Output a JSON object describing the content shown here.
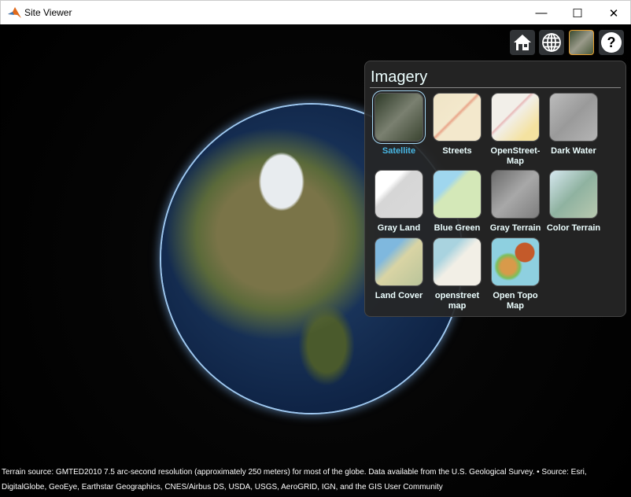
{
  "window": {
    "title": "Site Viewer",
    "minimize": "—",
    "maximize": "☐",
    "close": "✕"
  },
  "toolbar": [
    {
      "name": "home-button",
      "icon": "home-icon"
    },
    {
      "name": "globe-button",
      "icon": "globe-icon"
    },
    {
      "name": "imagery-button",
      "icon": "imagery-icon"
    },
    {
      "name": "help-button",
      "icon": "help-icon",
      "label": "?"
    }
  ],
  "imagery": {
    "title": "Imagery",
    "selected": "Satellite",
    "items": [
      {
        "label": "Satellite",
        "bg": "linear-gradient(135deg,#2e3a28,#7a8070 50%,#3a4430)"
      },
      {
        "label": "Streets",
        "bg": "linear-gradient(135deg,#efe4c6,#f3e8cc 45%,#e9a488 48%,#f3e8cc 52%)"
      },
      {
        "label": "OpenStreet-Map",
        "bg": "linear-gradient(135deg,#f2efe9 0 40%,#e8b8b8 42%,#f2efe9 46%,#f4e2a0 80%)"
      },
      {
        "label": "Dark Water",
        "bg": "linear-gradient(135deg,#bcbcbc,#9a9a9a 50%,#b5b5b5)"
      },
      {
        "label": "Gray Land",
        "bg": "linear-gradient(135deg,#fff 0 30%,#d6d6d6 40%,#d9d9d9)"
      },
      {
        "label": "Blue Green",
        "bg": "linear-gradient(135deg,#9fd6ee 0 30%,#d4e8b8 40%,#d4e8b8)"
      },
      {
        "label": "Gray Terrain",
        "bg": "linear-gradient(135deg,#6a6a6a,#a8a8a8 50%,#7d7d7d)"
      },
      {
        "label": "Color Terrain",
        "bg": "linear-gradient(135deg,#d6e8f0,#8fb2a0 50%,#b8c9b0)"
      },
      {
        "label": "Land Cover",
        "bg": "linear-gradient(135deg,#7fb8de 0 30%,#d9d4a4 50%,#b9c49a)"
      },
      {
        "label": "openstreetmap",
        "bg": "linear-gradient(135deg,#a9d3df 0 30%,#f2efe6 50%,#f2efe6)"
      },
      {
        "label": "Open Topo Map",
        "bg": "radial-gradient(circle at 70% 30%,#c45a2a 0 20%,transparent 22%),radial-gradient(circle at 35% 60%,#d89a4a 0 18%,#7cbf5a 28%,transparent 34%),#8ed0e0"
      }
    ]
  },
  "attribution": "Terrain source: GMTED2010 7.5 arc-second resolution (approximately 250 meters) for most of the globe. Data available from the U.S. Geological Survey. • Source: Esri, DigitalGlobe, GeoEye, Earthstar Geographics, CNES/Airbus DS, USDA, USGS, AeroGRID, IGN, and the GIS User Community"
}
